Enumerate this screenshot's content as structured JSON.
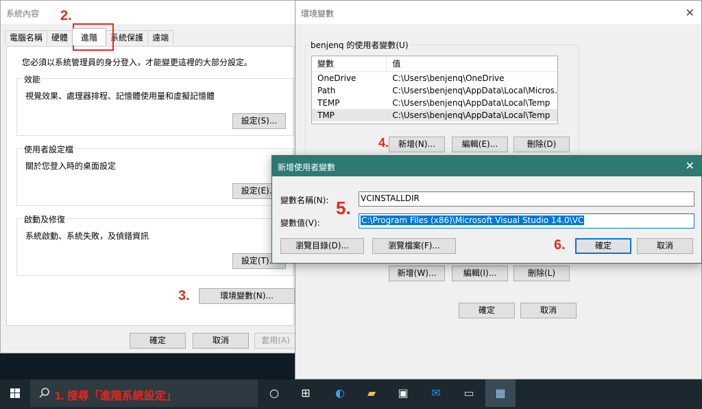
{
  "sysprop": {
    "title": "系統內容",
    "tabs": [
      "電腦名稱",
      "硬體",
      "進階",
      "系統保護",
      "遠端"
    ],
    "notice": "您必須以系統管理員的身分登入，才能變更這裡的大部分設定。",
    "performance": {
      "title": "效能",
      "desc": "視覺效果、處理器排程、記憶體使用量和虛擬記憶體",
      "button": "設定(S)..."
    },
    "profiles": {
      "title": "使用者設定檔",
      "desc": "關於您登入時的桌面設定",
      "button": "設定(E)..."
    },
    "startup": {
      "title": "啟動及修復",
      "desc": "系統啟動、系統失敗，及偵錯資訊",
      "button": "設定(T)..."
    },
    "env_button": "環境變數(N)...",
    "ok": "確定",
    "cancel": "取消",
    "apply": "套用(A)"
  },
  "envwin": {
    "title": "環境變數",
    "user_group": "benjenq 的使用者變數(U)",
    "columns": [
      "變數",
      "值"
    ],
    "rows": [
      {
        "name": "OneDrive",
        "value": "C:\\Users\\benjenq\\OneDrive"
      },
      {
        "name": "Path",
        "value": "C:\\Users\\benjenq\\AppData\\Local\\Micros..."
      },
      {
        "name": "TEMP",
        "value": "C:\\Users\\benjenq\\AppData\\Local\\Temp"
      },
      {
        "name": "TMP",
        "value": "C:\\Users\\benjenq\\AppData\\Local\\Temp"
      }
    ],
    "user_new": "新增(N)...",
    "user_edit": "編輯(E)...",
    "user_delete": "刪除(D)",
    "sys_new": "新增(W)...",
    "sys_edit": "編輯(I)...",
    "sys_delete": "刪除(L)",
    "ok": "確定",
    "cancel": "取消"
  },
  "newvar": {
    "title": "新增使用者變數",
    "name_label": "變數名稱(N):",
    "name_value": "VCINSTALLDIR",
    "value_label": "變數值(V):",
    "value_value": "C:\\Program Files (x86)\\Microsoft Visual Studio 14.0\\VC",
    "browse_dir": "瀏覽目錄(D)...",
    "browse_file": "瀏覽檔案(F)...",
    "ok": "確定",
    "cancel": "取消"
  },
  "steps": {
    "s1": "1. 搜尋「進階系統設定」",
    "s2": "2.",
    "s3": "3.",
    "s4": "4.",
    "s5": "5.",
    "s6": "6."
  },
  "colors": {
    "accent": "#0078d7",
    "dialog_title": "#2d7a72",
    "annotation": "#e8271a"
  }
}
